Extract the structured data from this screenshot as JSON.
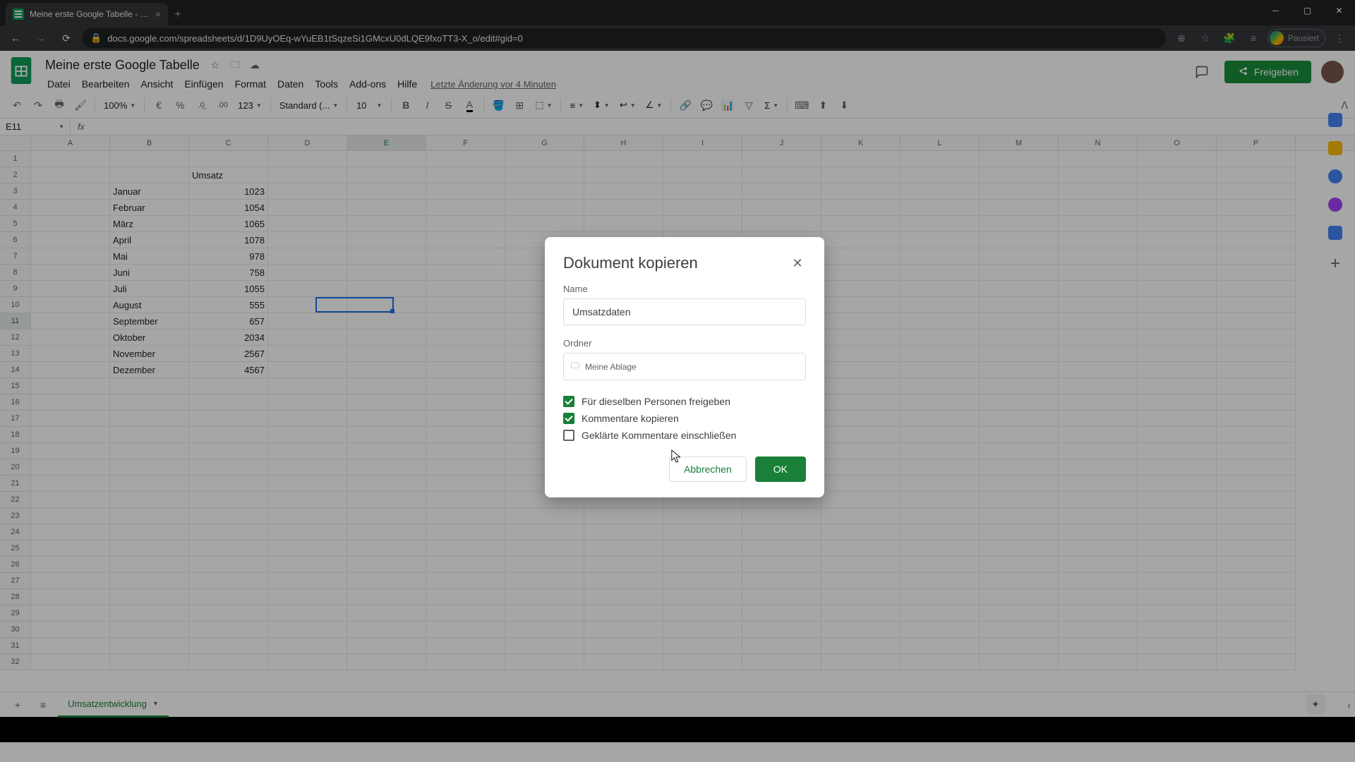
{
  "browser": {
    "tab_title": "Meine erste Google Tabelle - Go",
    "url": "docs.google.com/spreadsheets/d/1D9UyOEq-wYuEB1tSqzeSi1GMcxU0dLQE9fxoTT3-X_o/edit#gid=0",
    "profile_status": "Pausiert"
  },
  "doc": {
    "title": "Meine erste Google Tabelle",
    "last_edit": "Letzte Änderung vor 4 Minuten",
    "share": "Freigeben"
  },
  "menu": {
    "datei": "Datei",
    "bearbeiten": "Bearbeiten",
    "ansicht": "Ansicht",
    "einfuegen": "Einfügen",
    "format": "Format",
    "daten": "Daten",
    "tools": "Tools",
    "addons": "Add-ons",
    "hilfe": "Hilfe"
  },
  "toolbar": {
    "zoom": "100%",
    "euro": "€",
    "percent": "%",
    "dec_minus": ".0",
    "dec_plus": ".00",
    "num_fmt": "123",
    "font": "Standard (...",
    "font_size": "10"
  },
  "formula": {
    "cell_ref": "E11"
  },
  "columns": [
    "A",
    "B",
    "C",
    "D",
    "E",
    "F",
    "G",
    "H",
    "I",
    "J",
    "K",
    "L",
    "M",
    "N",
    "O",
    "P"
  ],
  "rows": [
    "1",
    "2",
    "3",
    "4",
    "5",
    "6",
    "7",
    "8",
    "9",
    "10",
    "11",
    "12",
    "13",
    "14",
    "15",
    "16",
    "17",
    "18",
    "19",
    "20",
    "21",
    "22",
    "23",
    "24",
    "25",
    "26",
    "27",
    "28",
    "29",
    "30",
    "31",
    "32"
  ],
  "sheet_data": {
    "header": "Umsatz",
    "months": [
      "Januar",
      "Februar",
      "März",
      "April",
      "Mai",
      "Juni",
      "Juli",
      "August",
      "September",
      "Oktober",
      "November",
      "Dezember"
    ],
    "values": [
      "1023",
      "1054",
      "1065",
      "1078",
      "978",
      "758",
      "1055",
      "555",
      "657",
      "2034",
      "2567",
      "4567"
    ]
  },
  "active_cell": {
    "col": 4,
    "row": 10
  },
  "sheet_tab": "Umsatzentwicklung",
  "dialog": {
    "title": "Dokument kopieren",
    "name_label": "Name",
    "name_value": "Umsatzdaten",
    "folder_label": "Ordner",
    "folder_value": "Meine Ablage",
    "chk_share": "Für dieselben Personen freigeben",
    "chk_comments": "Kommentare kopieren",
    "chk_resolved": "Geklärte Kommentare einschließen",
    "cancel": "Abbrechen",
    "ok": "OK"
  }
}
